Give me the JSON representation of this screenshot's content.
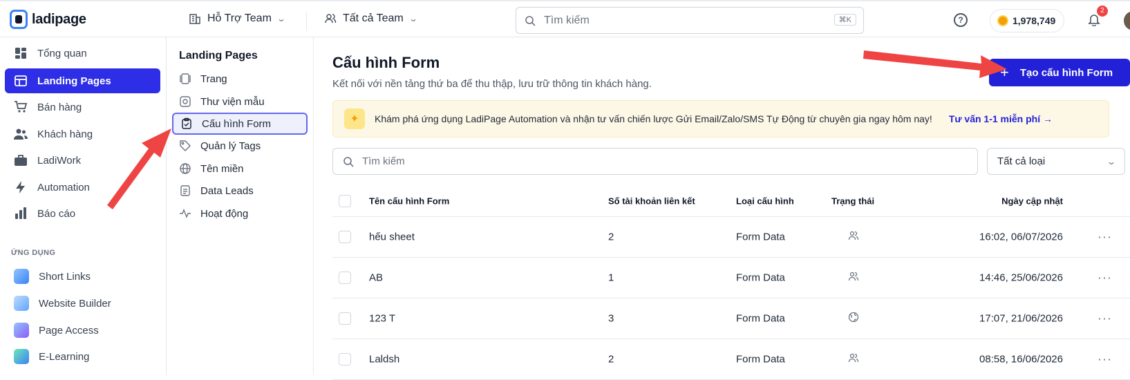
{
  "app": {
    "logo_text": "ladipage"
  },
  "topbar": {
    "team1": "Hỗ Trợ Team",
    "team2": "Tất cả Team",
    "search_placeholder": "Tìm kiếm",
    "search_shortcut": "⌘K",
    "credits": "1,978,749",
    "notifications_count": "2"
  },
  "sidebar": {
    "items": [
      {
        "label": "Tổng quan",
        "icon": "dashboard-icon"
      },
      {
        "label": "Landing Pages",
        "icon": "layout-icon",
        "active": true
      },
      {
        "label": "Bán hàng",
        "icon": "cart-icon"
      },
      {
        "label": "Khách hàng",
        "icon": "users-icon"
      },
      {
        "label": "LadiWork",
        "icon": "briefcase-icon"
      },
      {
        "label": "Automation",
        "icon": "bolt-icon"
      },
      {
        "label": "Báo cáo",
        "icon": "bar-chart-icon"
      }
    ],
    "apps_title": "ỨNG DỤNG",
    "apps": [
      {
        "label": "Short Links",
        "icon": "link-app-icon",
        "color": "#60a5fa"
      },
      {
        "label": "Website Builder",
        "icon": "website-app-icon",
        "color": "#93c5fd"
      },
      {
        "label": "Page Access",
        "icon": "lock-app-icon",
        "color": "#a78bfa"
      },
      {
        "label": "E-Learning",
        "icon": "graduation-app-icon",
        "color": "#34d399"
      }
    ]
  },
  "subnav": {
    "title": "Landing Pages",
    "items": [
      {
        "label": "Trang",
        "icon": "pages-icon"
      },
      {
        "label": "Thư viện mẫu",
        "icon": "template-icon"
      },
      {
        "label": "Cấu hình Form",
        "icon": "clipboard-check-icon",
        "active": true
      },
      {
        "label": "Quản lý Tags",
        "icon": "tag-icon"
      },
      {
        "label": "Tên miền",
        "icon": "globe-icon"
      },
      {
        "label": "Data Leads",
        "icon": "document-icon"
      },
      {
        "label": "Hoạt động",
        "icon": "activity-icon"
      }
    ]
  },
  "main": {
    "title": "Cấu hình Form",
    "subtitle": "Kết nối với nền tảng thứ ba để thu thập, lưu trữ thông tin khách hàng.",
    "create_button": "Tạo cấu hình Form",
    "banner_text": "Khám phá ứng dụng LadiPage Automation và nhận tư vấn chiến lược Gửi Email/Zalo/SMS Tự Động từ chuyên gia ngay hôm nay!",
    "banner_link": "Tư vấn 1-1 miễn phí →",
    "search_placeholder": "Tìm kiếm",
    "type_filter": "Tất cả loại"
  },
  "table": {
    "headers": {
      "name": "Tên cấu hình Form",
      "count": "Số tài khoản liên kết",
      "type": "Loại cấu hình",
      "status": "Trạng thái",
      "date": "Ngày cập nhật"
    },
    "rows": [
      {
        "name": "hếu sheet",
        "count": "2",
        "type": "Form Data",
        "status_icon": "users-icon",
        "date": "16:02, 06/07/2026"
      },
      {
        "name": "AB",
        "count": "1",
        "type": "Form Data",
        "status_icon": "users-icon",
        "date": "14:46, 25/06/2026"
      },
      {
        "name": "123 T",
        "count": "3",
        "type": "Form Data",
        "status_icon": "globe-icon",
        "date": "17:07, 21/06/2026"
      },
      {
        "name": "Laldsh",
        "count": "2",
        "type": "Form Data",
        "status_icon": "users-icon",
        "date": "08:58, 16/06/2026"
      }
    ],
    "more_label": "···"
  },
  "colors": {
    "accent": "#2321d8",
    "arrow": "#ef4444",
    "banner_bg": "#fdf8e6"
  }
}
